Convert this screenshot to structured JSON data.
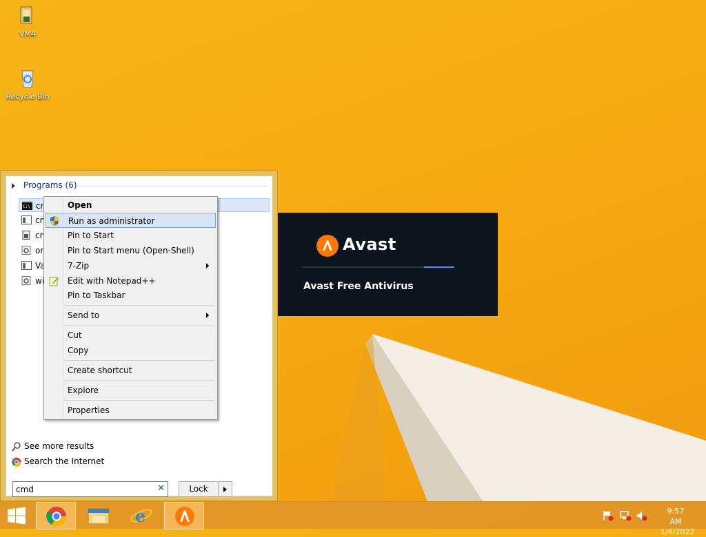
{
  "desktop": {
    "icons": [
      {
        "label": "VM4",
        "icon": "folder-icon"
      },
      {
        "label": "Recycle Bin",
        "icon": "recycle-bin-icon"
      }
    ]
  },
  "start_menu": {
    "programs_header": "Programs (6)",
    "programs": [
      {
        "label": "cm",
        "icon": "cmd-icon",
        "selected": true
      },
      {
        "label": "cm",
        "icon": "window-icon"
      },
      {
        "label": "cm",
        "icon": "script-icon"
      },
      {
        "label": "on",
        "icon": "gear-file-icon"
      },
      {
        "label": "Va",
        "icon": "window-icon"
      },
      {
        "label": "wi",
        "icon": "gear-file-icon"
      }
    ],
    "see_more": "See more results",
    "search_internet": "Search the Internet",
    "search_value": "cmd",
    "clear_symbol": "✕",
    "lock_label": "Lock"
  },
  "context_menu": {
    "items": [
      {
        "label": "Open",
        "bold": true
      },
      {
        "label": "Run as administrator",
        "highlighted": true,
        "icon": "shield-icon"
      },
      {
        "label": "Pin to Start"
      },
      {
        "label": "Pin to Start menu (Open-Shell)"
      },
      {
        "label": "7-Zip",
        "submenu": true
      },
      {
        "label": "Edit with Notepad++",
        "icon": "notepad-plus-icon"
      },
      {
        "label": "Pin to Taskbar"
      },
      {
        "label": "Send to",
        "submenu": true
      },
      {
        "label": "Cut"
      },
      {
        "label": "Copy"
      },
      {
        "label": "Create shortcut"
      },
      {
        "label": "Explore"
      },
      {
        "label": "Properties"
      }
    ]
  },
  "avast_splash": {
    "title": "Avast",
    "product": "Avast Free Antivirus",
    "progress": 0.2
  },
  "taskbar": {
    "time": "9:57 AM",
    "date": "1/4/2022",
    "apps": [
      "windows-start-icon",
      "chrome-icon",
      "file-explorer-icon",
      "internet-explorer-icon",
      "avast-icon"
    ]
  },
  "colors": {
    "wallpaper": "#f6ab12",
    "accent_orange": "#ff7800",
    "splash_bg": "#0c151d",
    "highlight": "#d8e6f7"
  }
}
